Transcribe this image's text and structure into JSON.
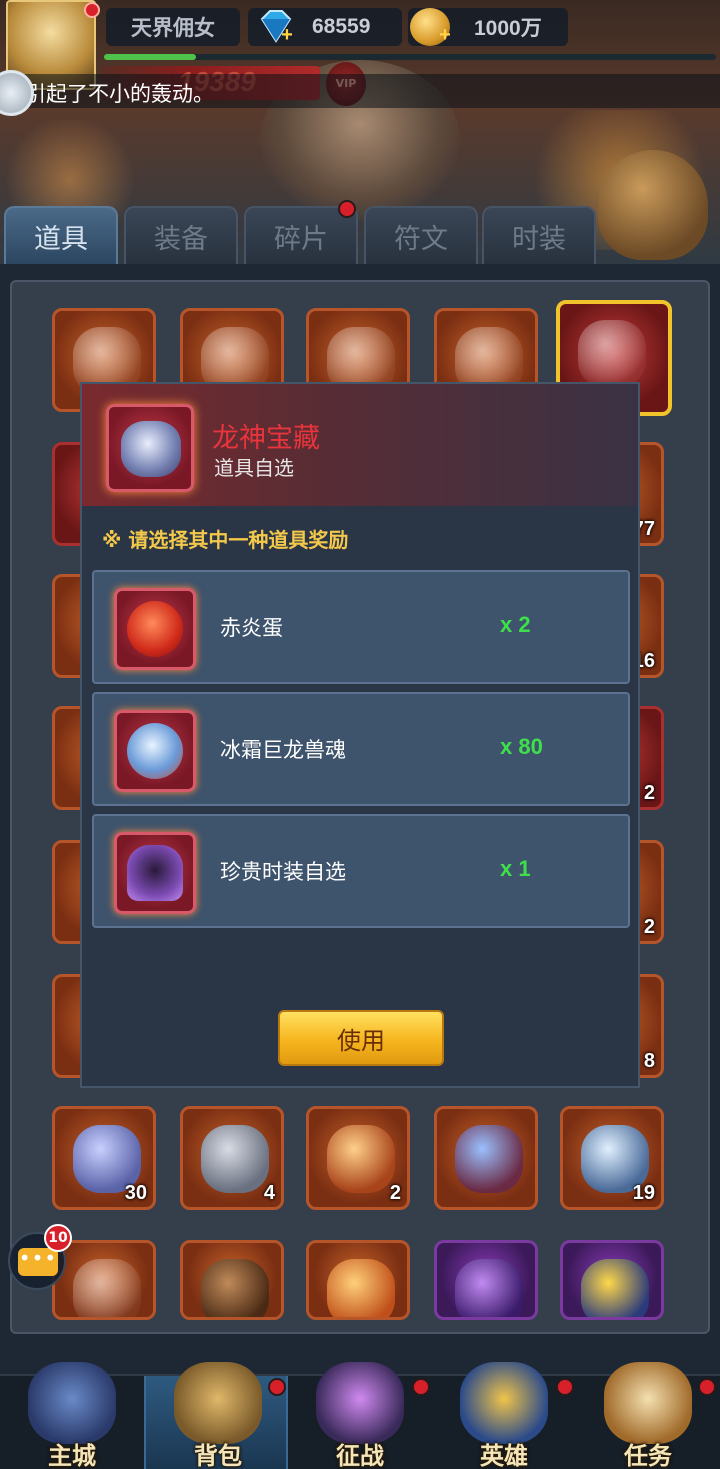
{
  "header": {
    "player_name": "天界佣女",
    "gems": "68559",
    "gold": "1000万",
    "power": "19389",
    "vip_label": "VIP",
    "exp_progress": 0.15,
    "marquee": "阔引起了不小的轰动。"
  },
  "tabs": [
    {
      "label": "道具",
      "active": true
    },
    {
      "label": "装备",
      "active": false
    },
    {
      "label": "碎片",
      "active": false
    },
    {
      "label": "符文",
      "active": false
    },
    {
      "label": "时装",
      "active": false
    }
  ],
  "grid": {
    "counts": {
      "row2_col5": "77",
      "row3_col5": "16",
      "row4_col5": "2",
      "row5_col5": "2",
      "row6_col5": "8",
      "row7_col1": "30",
      "row7_col2": "4",
      "row7_col3": "2",
      "row7_col5": "19"
    }
  },
  "chat": {
    "badge": "10"
  },
  "modal": {
    "title": "龙神宝藏",
    "subtitle": "道具自选",
    "hint": "※ 请选择其中一种道具奖励",
    "rewards": [
      {
        "name": "赤炎蛋",
        "qty": "x 2"
      },
      {
        "name": "冰霜巨龙兽魂",
        "qty": "x 80"
      },
      {
        "name": "珍贵时装自选",
        "qty": "x 1"
      }
    ],
    "use_label": "使用"
  },
  "nav": [
    {
      "label": "主城"
    },
    {
      "label": "背包"
    },
    {
      "label": "征战"
    },
    {
      "label": "英雄"
    },
    {
      "label": "任务"
    }
  ],
  "colors": {
    "title_red": "#e8343a",
    "hint_yellow": "#f4c84a",
    "qty_green": "#3ee04a",
    "use_button": "#f6b51e",
    "badge_red": "#d8202a"
  }
}
